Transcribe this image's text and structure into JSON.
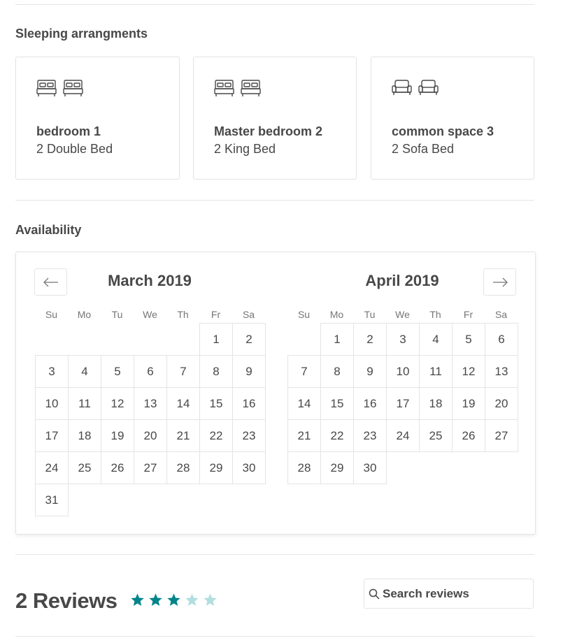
{
  "sleeping": {
    "title": "Sleeping arrangments",
    "rooms": [
      {
        "name": "bedroom 1",
        "beds": "2 Double Bed",
        "icon": "double-bed-icon"
      },
      {
        "name": "Master bedroom 2",
        "beds": "2 King Bed",
        "icon": "king-bed-icon"
      },
      {
        "name": "common space 3",
        "beds": "2 Sofa Bed",
        "icon": "sofa-bed-icon"
      }
    ]
  },
  "availability": {
    "title": "Availability",
    "prev_icon": "arrow-left-icon",
    "next_icon": "arrow-right-icon",
    "weekdays": [
      "Su",
      "Mo",
      "Tu",
      "We",
      "Th",
      "Fr",
      "Sa"
    ],
    "months": [
      {
        "label": "March 2019",
        "first_weekday": 5,
        "days": 31
      },
      {
        "label": "April 2019",
        "first_weekday": 1,
        "days": 30
      }
    ]
  },
  "reviews": {
    "title": "2 Reviews",
    "rating": 3,
    "max_rating": 5,
    "star_color": "#008489",
    "star_empty_color": "#b2dedf",
    "search_placeholder": "Search reviews",
    "search_icon": "search-icon"
  }
}
